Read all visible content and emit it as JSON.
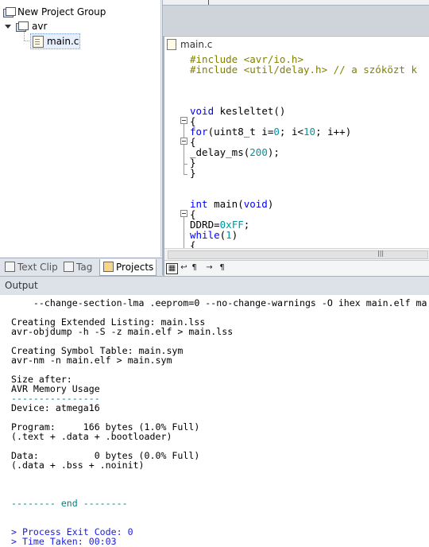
{
  "project_tree": {
    "group_label": "New Project Group",
    "project_label": "avr",
    "file_label": "main.c"
  },
  "left_tabs": [
    {
      "label": "Text Clip"
    },
    {
      "label": "Tag"
    },
    {
      "label": "Projects"
    }
  ],
  "editor": {
    "tab_label": "main.c",
    "lines": [
      [
        "#include <avr/io.h>"
      ],
      [
        "#include <util/delay.h> // a szóközt k"
      ],
      [
        ""
      ],
      [
        ""
      ],
      [
        "void",
        " kesleltet()"
      ],
      [
        "{"
      ],
      [
        "for",
        "(uint8_t i=",
        "0",
        "; i<",
        "10",
        "; i++)"
      ],
      [
        "{"
      ],
      [
        "_delay_ms(",
        "200",
        ");"
      ],
      [
        "}"
      ],
      [
        "}"
      ],
      [
        ""
      ],
      [
        ""
      ],
      [
        "int",
        " main(",
        "void",
        ")"
      ],
      [
        "{"
      ],
      [
        "DDRD=",
        "0xFF",
        ";"
      ],
      [
        "while",
        "(",
        "1",
        ")"
      ],
      [
        "{"
      ]
    ],
    "bottom_toolbar": [
      "▦",
      "↩",
      "¶",
      "→",
      "¶"
    ]
  },
  "output": {
    "title": "Output",
    "lines": [
      {
        "text": "    --change-section-lma .eeprom=0 --no-change-warnings -O ihex main.elf ma",
        "color": "normal"
      },
      {
        "text": "",
        "color": "normal"
      },
      {
        "text": "Creating Extended Listing: main.lss",
        "color": "normal"
      },
      {
        "text": "avr-objdump -h -S -z main.elf > main.lss",
        "color": "normal"
      },
      {
        "text": "",
        "color": "normal"
      },
      {
        "text": "Creating Symbol Table: main.sym",
        "color": "normal"
      },
      {
        "text": "avr-nm -n main.elf > main.sym",
        "color": "normal"
      },
      {
        "text": "",
        "color": "normal"
      },
      {
        "text": "Size after:",
        "color": "normal"
      },
      {
        "text": "AVR Memory Usage",
        "color": "normal"
      },
      {
        "text": "----------------",
        "color": "green"
      },
      {
        "text": "Device: atmega16",
        "color": "normal"
      },
      {
        "text": "",
        "color": "normal"
      },
      {
        "text": "Program:     166 bytes (1.0% Full)",
        "color": "normal"
      },
      {
        "text": "(.text + .data + .bootloader)",
        "color": "normal"
      },
      {
        "text": "",
        "color": "normal"
      },
      {
        "text": "Data:          0 bytes (0.0% Full)",
        "color": "normal"
      },
      {
        "text": "(.data + .bss + .noinit)",
        "color": "normal"
      },
      {
        "text": "",
        "color": "normal"
      },
      {
        "text": "",
        "color": "normal"
      },
      {
        "text": "",
        "color": "normal"
      },
      {
        "text": "-------- end --------",
        "color": "green"
      },
      {
        "text": "",
        "color": "normal"
      },
      {
        "text": "",
        "color": "normal"
      },
      {
        "text": "> Process Exit Code: 0",
        "color": "blue"
      },
      {
        "text": "> Time Taken: 00:03",
        "color": "blue"
      }
    ]
  },
  "colors": {
    "preprocessor": "#808000",
    "keyword": "#0000ff",
    "number": "#0096a0",
    "output_green": "#008080",
    "output_blue": "#1a1ae6"
  }
}
